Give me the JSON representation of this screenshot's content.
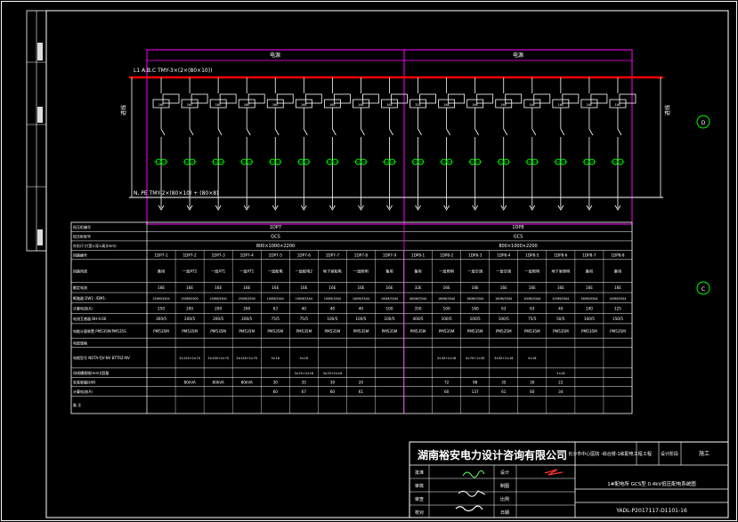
{
  "sections": {
    "left": "电源",
    "right": "电源"
  },
  "busbar": {
    "top": "L1 A.B.C TMY-3×(2×(80×10))",
    "bottom": "N, PE  TMY-2×(80×10) + (80×8)"
  },
  "source_labels": {
    "left": "进线",
    "right": "进线"
  },
  "axis_markers": [
    "D",
    "C"
  ],
  "group_ids": [
    "1DP7",
    "1DP8"
  ],
  "row_headers": [
    "低压柜编号",
    "低压柜型号",
    "外形尺寸(宽×深×高)(mm)",
    "回路编号",
    "回路用途",
    "额定电流",
    "断路器 DW1- /DM1-",
    "计算电流(A)",
    "电流互感器 BH-0.66",
    "电能计量装置 PM535M/PM535S",
    "电缆规格",
    "电缆型号 NDTA-YJV-NV BTTRZ-NV",
    "母线槽规格(mm)/容量",
    "安装容量(kW)",
    "计算电流(A)",
    "备 注"
  ],
  "groups": [
    {
      "panel": "1DP7",
      "model": "GCS",
      "size": "800×1000×2200"
    },
    {
      "panel": "1DP8",
      "model": "GCS",
      "size": "800×1000×2200"
    }
  ],
  "circuits": [
    {
      "id": "1DP7-1",
      "use": "备用",
      "frame": "16E",
      "breaker": "250M/3344",
      "setting": "250",
      "ct": "300/5",
      "meter": "PM535M",
      "cable": "",
      "bus": "",
      "kw": "",
      "ia": ""
    },
    {
      "id": "1DP7-2",
      "use": "一层AT2",
      "frame": "16E",
      "breaker": "250M/3300",
      "setting": "200",
      "ct": "200/5",
      "meter": "PM535M",
      "cable": "3×150+2×70",
      "bus": "",
      "kw": "80kVA",
      "ia": ""
    },
    {
      "id": "1DP7-3",
      "use": "一层AT1",
      "frame": "16E",
      "breaker": "250M/3300",
      "setting": "200",
      "ct": "200/5",
      "meter": "PM535M",
      "cable": "3×150+2×70",
      "bus": "",
      "kw": "80kVA",
      "ia": ""
    },
    {
      "id": "1DP7-4",
      "use": "一层AT1",
      "frame": "16E",
      "breaker": "250M/3300",
      "setting": "200",
      "ct": "200/5",
      "meter": "PM535M",
      "cable": "3×150+2×70",
      "bus": "",
      "kw": "80kVA",
      "ia": ""
    },
    {
      "id": "1DP7-5",
      "use": "一层配电",
      "frame": "16E",
      "breaker": "100M/3344",
      "setting": "63",
      "ct": "75/5",
      "meter": "PM535M",
      "cable": "5×16",
      "bus": "",
      "kw": "30",
      "ia": "60"
    },
    {
      "id": "1DP7-6",
      "use": "一层配电2",
      "frame": "16E",
      "breaker": "100M/3344",
      "setting": "40",
      "ct": "75/5",
      "meter": "PM535M",
      "cable": "5×16",
      "bus": "3×25+2×16",
      "kw": "35",
      "ia": "67"
    },
    {
      "id": "1DP7-7",
      "use": "地下室配电",
      "frame": "16E",
      "breaker": "100M/3344",
      "setting": "40",
      "ct": "100/5",
      "meter": "PM535M",
      "cable": "",
      "bus": "3×25+2×16",
      "kw": "39",
      "ia": "60"
    },
    {
      "id": "1DP7-8",
      "use": "一层照明",
      "frame": "16E",
      "breaker": "100M/3344",
      "setting": "40",
      "ct": "100/5",
      "meter": "PM535M",
      "cable": "",
      "bus": "",
      "kw": "20",
      "ia": "61"
    },
    {
      "id": "1DP7-9",
      "use": "备用",
      "frame": "16E",
      "breaker": "100M/3344",
      "setting": "100",
      "ct": "100/5",
      "meter": "PM535M",
      "cable": "",
      "bus": "",
      "kw": "",
      "ia": ""
    },
    {
      "id": "1DP8-1",
      "use": "备用",
      "frame": "32E",
      "breaker": "400M/3344",
      "setting": "350",
      "ct": "400/5",
      "meter": "PM535M",
      "cable": "",
      "bus": "",
      "kw": "",
      "ia": ""
    },
    {
      "id": "1DP8-2",
      "use": "一层照明",
      "frame": "16E",
      "breaker": "160M/3344",
      "setting": "100",
      "ct": "100/5",
      "meter": "PM535M",
      "cable": "3×35+2×16",
      "bus": "",
      "kw": "72",
      "ia": "60"
    },
    {
      "id": "1DP8-3",
      "use": "一层空调",
      "frame": "16E",
      "breaker": "160M/3344",
      "setting": "160",
      "ct": "100/5",
      "meter": "PM535M",
      "cable": "4×70+1×35",
      "bus": "",
      "kw": "98",
      "ia": "137"
    },
    {
      "id": "1DP8-4",
      "use": "一层空调",
      "frame": "16E",
      "breaker": "160M/3344",
      "setting": "63",
      "ct": "100/5",
      "meter": "PM535M",
      "cable": "3×35+2×16",
      "bus": "",
      "kw": "35",
      "ia": "61"
    },
    {
      "id": "1DP8-5",
      "use": "一层照明",
      "frame": "16E",
      "breaker": "100M/3344",
      "setting": "63",
      "ct": "75/5",
      "meter": "PM535M",
      "cable": "5×16",
      "bus": "",
      "kw": "30",
      "ia": "60"
    },
    {
      "id": "1DP8-6",
      "use": "地下室照明",
      "frame": "16E",
      "breaker": "100M/3344",
      "setting": "40",
      "ct": "50/5",
      "meter": "PM535M",
      "cable": "",
      "bus": "5×16",
      "kw": "22",
      "ia": "34"
    },
    {
      "id": "1DP8-7",
      "use": "备用",
      "frame": "16E",
      "breaker": "160M/3344",
      "setting": "100",
      "ct": "100/5",
      "meter": "PM535M",
      "cable": "",
      "bus": "",
      "kw": "",
      "ia": ""
    },
    {
      "id": "1DP8-8",
      "use": "备用",
      "frame": "16E",
      "breaker": "160M/3344",
      "setting": "125",
      "ct": "150/5",
      "meter": "PM535M",
      "cable": "",
      "bus": "",
      "kw": "",
      "ia": ""
    }
  ],
  "title_block": {
    "company": "湖南裕安电力设计咨询有限公司",
    "project": "长沙市中心医院 -综合楼-1栋配电工程",
    "labels": [
      "工程",
      "设计阶段",
      "施工"
    ],
    "roles": [
      "批准",
      "审核",
      "审查",
      "校对",
      "设计",
      "制图",
      "比例",
      "日期"
    ],
    "drawing_title": "1#配电所 GCS型 0.4kV低压配电系统图",
    "drawing_number": "YADL-P2017117-D1101-16"
  },
  "colors": {
    "frame": "#ffffff",
    "magenta": "#ff00ff",
    "busbar": "#ff0000",
    "breaker": "#ffffff",
    "green": "#00ff00",
    "cyan": "#00ffff"
  }
}
